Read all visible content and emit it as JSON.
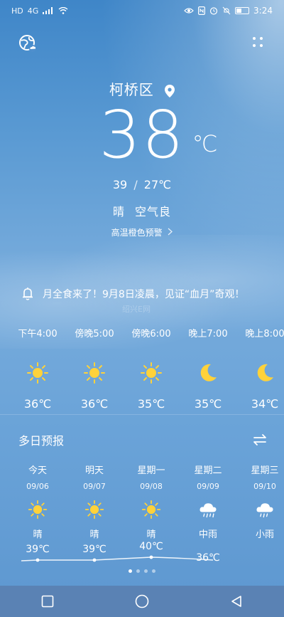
{
  "status_bar": {
    "left_icons": [
      "HD",
      "4G"
    ],
    "time": "3:24",
    "battery_level": 0.4
  },
  "location": {
    "name": "柯桥区"
  },
  "current": {
    "temp": "38",
    "unit": "℃",
    "high": "39",
    "low_with_unit": "27℃",
    "separator": "/",
    "condition": "晴",
    "air_quality": "空气良",
    "warning": "高温橙色预警"
  },
  "notice": {
    "text": "月全食来了！9月8日凌晨，见证“血月”奇观！"
  },
  "watermark": {
    "text": "绍兴E网"
  },
  "hourly": [
    {
      "time": "下午4:00",
      "icon": "sun-icon",
      "temp": "36℃"
    },
    {
      "time": "傍晚5:00",
      "icon": "sun-icon",
      "temp": "36℃"
    },
    {
      "time": "傍晚6:00",
      "icon": "sun-icon",
      "temp": "35℃"
    },
    {
      "time": "晚上7:00",
      "icon": "moon-icon",
      "temp": "35℃"
    },
    {
      "time": "晚上8:00",
      "icon": "moon-icon",
      "temp": "34℃"
    }
  ],
  "daily_title": "多日预报",
  "daily": [
    {
      "name": "今天",
      "date": "09/06",
      "icon": "sun-icon",
      "cond": "晴",
      "high": "39℃"
    },
    {
      "name": "明天",
      "date": "09/07",
      "icon": "sun-icon",
      "cond": "晴",
      "high": "39℃"
    },
    {
      "name": "星期一",
      "date": "09/08",
      "icon": "sun-icon",
      "cond": "晴",
      "high": "40℃"
    },
    {
      "name": "星期二",
      "date": "09/09",
      "icon": "rain-cloud-icon",
      "cond": "中雨",
      "high": "36℃"
    },
    {
      "name": "星期三",
      "date": "09/10",
      "icon": "rain-cloud-icon",
      "cond": "小雨",
      "high": ""
    }
  ],
  "pager": {
    "pages": 4,
    "active": 0
  },
  "colors": {
    "sun": "#ffd23a",
    "moon": "#ffd23a",
    "navbar": "#5a82b4"
  }
}
